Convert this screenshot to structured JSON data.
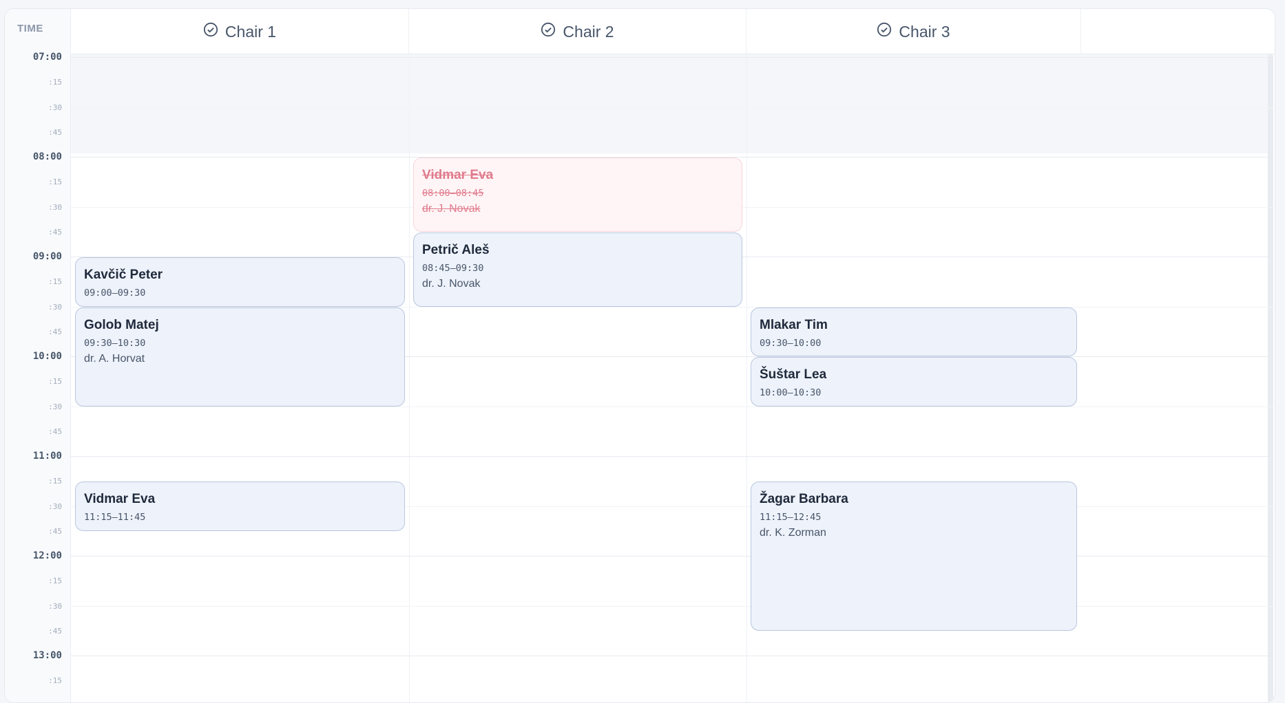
{
  "header": {
    "time_label": "TIME",
    "chairs": [
      {
        "label": "Chair 1",
        "icon": "check-circle-icon"
      },
      {
        "label": "Chair 2",
        "icon": "check-circle-icon"
      },
      {
        "label": "Chair 3",
        "icon": "check-circle-icon"
      }
    ]
  },
  "time_labels": [
    "07:00",
    ":15",
    ":30",
    ":45",
    "08:00",
    ":15",
    ":30",
    ":45",
    "09:00",
    ":15",
    ":30",
    ":45",
    "10:00",
    ":15",
    ":30",
    ":45",
    "11:00",
    ":15",
    ":30",
    ":45",
    "12:00",
    ":15",
    ":30",
    ":45",
    "13:00",
    ":15"
  ],
  "colors": {
    "appointment_bg": "#eef2fa",
    "appointment_border": "#b9c6de",
    "cancelled_bg": "#fff5f6",
    "cancelled_text": "#e07a8c",
    "offhours_bg": "#f4f6fa"
  },
  "appointments": [
    {
      "chair": 1,
      "name": "Kavčič Peter",
      "time": "09:00–09:30",
      "doctor": "",
      "start": "09:00",
      "end": "09:30",
      "status": "booked"
    },
    {
      "chair": 1,
      "name": "Golob Matej",
      "time": "09:30–10:30",
      "doctor": "dr. A. Horvat",
      "start": "09:30",
      "end": "10:30",
      "status": "booked"
    },
    {
      "chair": 1,
      "name": "Vidmar Eva",
      "time": "11:15–11:45",
      "doctor": "",
      "start": "11:15",
      "end": "11:45",
      "status": "booked"
    },
    {
      "chair": 2,
      "name": "Vidmar Eva",
      "time": "08:00–08:45",
      "doctor": "dr. J. Novak",
      "start": "08:00",
      "end": "08:45",
      "status": "cancelled"
    },
    {
      "chair": 2,
      "name": "Petrič Aleš",
      "time": "08:45–09:30",
      "doctor": "dr. J. Novak",
      "start": "08:45",
      "end": "09:30",
      "status": "booked"
    },
    {
      "chair": 3,
      "name": "Mlakar Tim",
      "time": "09:30–10:00",
      "doctor": "",
      "start": "09:30",
      "end": "10:00",
      "status": "booked"
    },
    {
      "chair": 3,
      "name": "Šuštar Lea",
      "time": "10:00–10:30",
      "doctor": "",
      "start": "10:00",
      "end": "10:30",
      "status": "booked"
    },
    {
      "chair": 3,
      "name": "Žagar Barbara",
      "time": "11:15–12:45",
      "doctor": "dr. K. Zorman",
      "start": "11:15",
      "end": "12:45",
      "status": "booked"
    }
  ]
}
